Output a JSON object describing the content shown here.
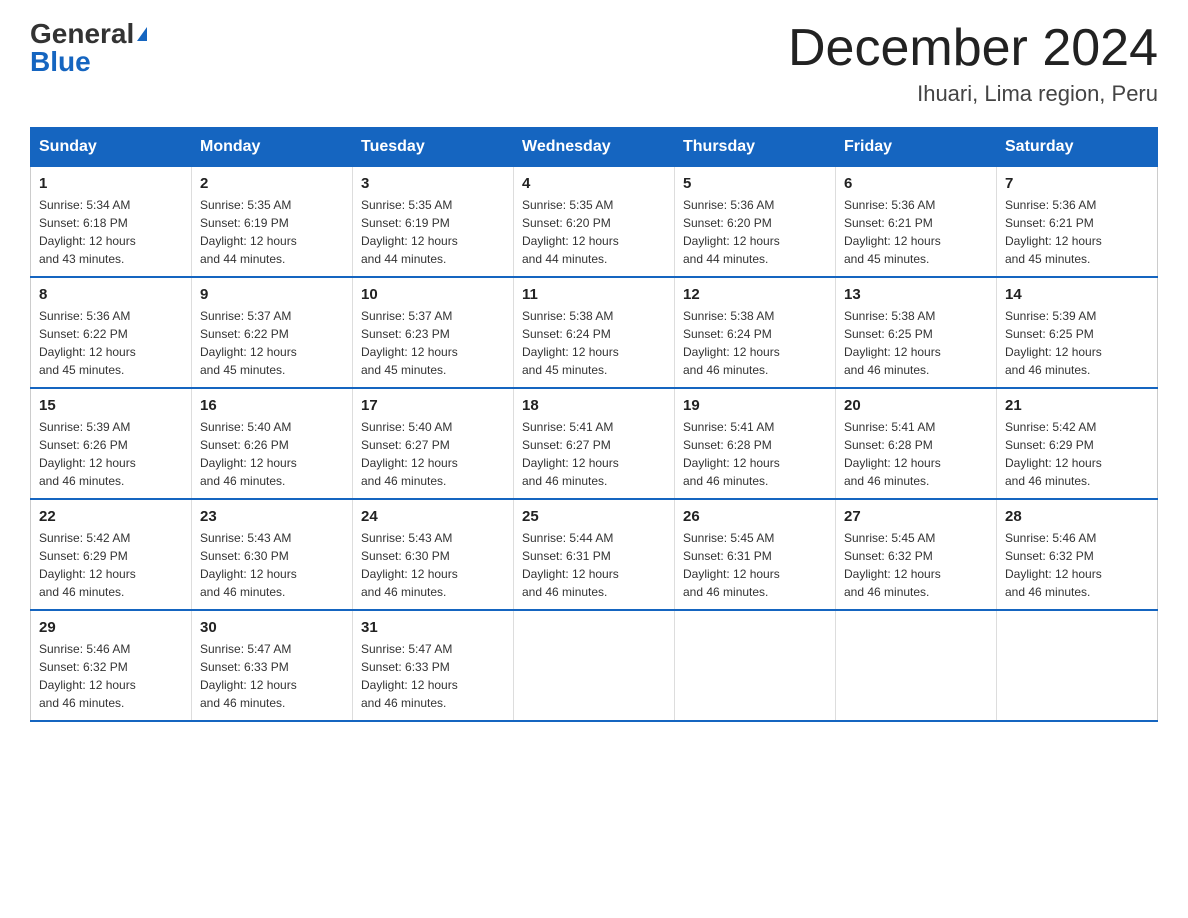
{
  "logo": {
    "general": "General",
    "blue": "Blue"
  },
  "header": {
    "month": "December 2024",
    "location": "Ihuari, Lima region, Peru"
  },
  "days_of_week": [
    "Sunday",
    "Monday",
    "Tuesday",
    "Wednesday",
    "Thursday",
    "Friday",
    "Saturday"
  ],
  "weeks": [
    [
      {
        "day": "1",
        "sunrise": "5:34 AM",
        "sunset": "6:18 PM",
        "daylight": "12 hours and 43 minutes."
      },
      {
        "day": "2",
        "sunrise": "5:35 AM",
        "sunset": "6:19 PM",
        "daylight": "12 hours and 44 minutes."
      },
      {
        "day": "3",
        "sunrise": "5:35 AM",
        "sunset": "6:19 PM",
        "daylight": "12 hours and 44 minutes."
      },
      {
        "day": "4",
        "sunrise": "5:35 AM",
        "sunset": "6:20 PM",
        "daylight": "12 hours and 44 minutes."
      },
      {
        "day": "5",
        "sunrise": "5:36 AM",
        "sunset": "6:20 PM",
        "daylight": "12 hours and 44 minutes."
      },
      {
        "day": "6",
        "sunrise": "5:36 AM",
        "sunset": "6:21 PM",
        "daylight": "12 hours and 45 minutes."
      },
      {
        "day": "7",
        "sunrise": "5:36 AM",
        "sunset": "6:21 PM",
        "daylight": "12 hours and 45 minutes."
      }
    ],
    [
      {
        "day": "8",
        "sunrise": "5:36 AM",
        "sunset": "6:22 PM",
        "daylight": "12 hours and 45 minutes."
      },
      {
        "day": "9",
        "sunrise": "5:37 AM",
        "sunset": "6:22 PM",
        "daylight": "12 hours and 45 minutes."
      },
      {
        "day": "10",
        "sunrise": "5:37 AM",
        "sunset": "6:23 PM",
        "daylight": "12 hours and 45 minutes."
      },
      {
        "day": "11",
        "sunrise": "5:38 AM",
        "sunset": "6:24 PM",
        "daylight": "12 hours and 45 minutes."
      },
      {
        "day": "12",
        "sunrise": "5:38 AM",
        "sunset": "6:24 PM",
        "daylight": "12 hours and 46 minutes."
      },
      {
        "day": "13",
        "sunrise": "5:38 AM",
        "sunset": "6:25 PM",
        "daylight": "12 hours and 46 minutes."
      },
      {
        "day": "14",
        "sunrise": "5:39 AM",
        "sunset": "6:25 PM",
        "daylight": "12 hours and 46 minutes."
      }
    ],
    [
      {
        "day": "15",
        "sunrise": "5:39 AM",
        "sunset": "6:26 PM",
        "daylight": "12 hours and 46 minutes."
      },
      {
        "day": "16",
        "sunrise": "5:40 AM",
        "sunset": "6:26 PM",
        "daylight": "12 hours and 46 minutes."
      },
      {
        "day": "17",
        "sunrise": "5:40 AM",
        "sunset": "6:27 PM",
        "daylight": "12 hours and 46 minutes."
      },
      {
        "day": "18",
        "sunrise": "5:41 AM",
        "sunset": "6:27 PM",
        "daylight": "12 hours and 46 minutes."
      },
      {
        "day": "19",
        "sunrise": "5:41 AM",
        "sunset": "6:28 PM",
        "daylight": "12 hours and 46 minutes."
      },
      {
        "day": "20",
        "sunrise": "5:41 AM",
        "sunset": "6:28 PM",
        "daylight": "12 hours and 46 minutes."
      },
      {
        "day": "21",
        "sunrise": "5:42 AM",
        "sunset": "6:29 PM",
        "daylight": "12 hours and 46 minutes."
      }
    ],
    [
      {
        "day": "22",
        "sunrise": "5:42 AM",
        "sunset": "6:29 PM",
        "daylight": "12 hours and 46 minutes."
      },
      {
        "day": "23",
        "sunrise": "5:43 AM",
        "sunset": "6:30 PM",
        "daylight": "12 hours and 46 minutes."
      },
      {
        "day": "24",
        "sunrise": "5:43 AM",
        "sunset": "6:30 PM",
        "daylight": "12 hours and 46 minutes."
      },
      {
        "day": "25",
        "sunrise": "5:44 AM",
        "sunset": "6:31 PM",
        "daylight": "12 hours and 46 minutes."
      },
      {
        "day": "26",
        "sunrise": "5:45 AM",
        "sunset": "6:31 PM",
        "daylight": "12 hours and 46 minutes."
      },
      {
        "day": "27",
        "sunrise": "5:45 AM",
        "sunset": "6:32 PM",
        "daylight": "12 hours and 46 minutes."
      },
      {
        "day": "28",
        "sunrise": "5:46 AM",
        "sunset": "6:32 PM",
        "daylight": "12 hours and 46 minutes."
      }
    ],
    [
      {
        "day": "29",
        "sunrise": "5:46 AM",
        "sunset": "6:32 PM",
        "daylight": "12 hours and 46 minutes."
      },
      {
        "day": "30",
        "sunrise": "5:47 AM",
        "sunset": "6:33 PM",
        "daylight": "12 hours and 46 minutes."
      },
      {
        "day": "31",
        "sunrise": "5:47 AM",
        "sunset": "6:33 PM",
        "daylight": "12 hours and 46 minutes."
      },
      null,
      null,
      null,
      null
    ]
  ],
  "labels": {
    "sunrise": "Sunrise:",
    "sunset": "Sunset:",
    "daylight": "Daylight:"
  }
}
